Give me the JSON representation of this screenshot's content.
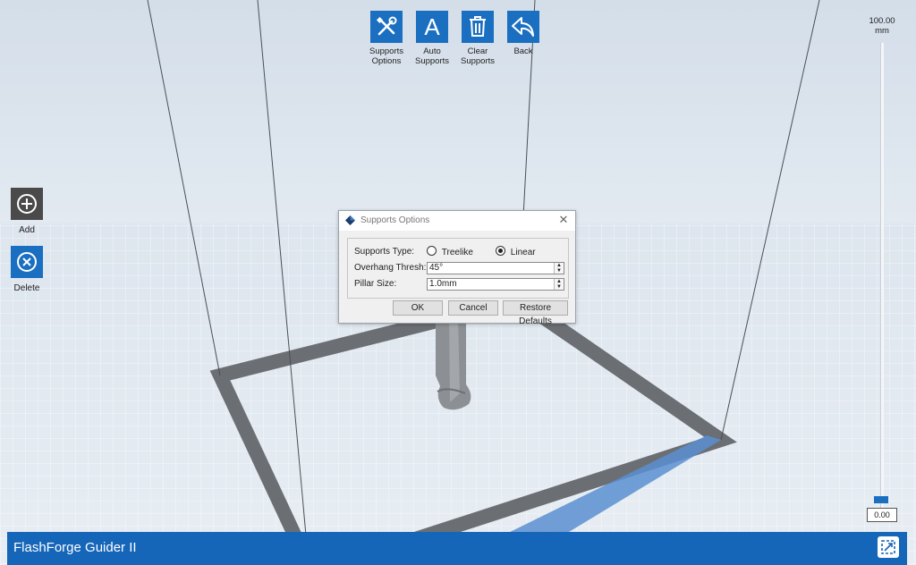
{
  "app": {
    "name": "FlashForge Guider II"
  },
  "toolbar": {
    "supports_options_label": "Supports\nOptions",
    "auto_supports_label": "Auto\nSupports",
    "clear_supports_label": "Clear\nSupports",
    "back_label": "Back",
    "auto_letter": "A"
  },
  "side": {
    "add_label": "Add",
    "delete_label": "Delete"
  },
  "slider": {
    "top_value": "100.00",
    "unit": "mm",
    "current_value": "0.00"
  },
  "dialog": {
    "title": "Supports Options",
    "close_glyph": "✕",
    "supports_type_label": "Supports Type:",
    "options": [
      "Treelike",
      "Linear"
    ],
    "selected": "Linear",
    "overhang_label": "Overhang Thresh:",
    "overhang_value": "45°",
    "pillar_label": "Pillar Size:",
    "pillar_value": "1.0mm",
    "ok": "OK",
    "cancel": "Cancel",
    "restore": "Restore Defaults"
  },
  "colors": {
    "accent": "#1a6fc0",
    "bottom_bar": "#1565b8",
    "side_add": "#4a4a4a",
    "side_delete": "#1a6fc0"
  },
  "icons": [
    "wrench-screwdriver-icon",
    "letter-a-icon",
    "trash-icon",
    "back-arrow-icon",
    "add-circle-icon",
    "delete-circle-icon",
    "app-logo-icon",
    "close-icon",
    "fit-view-icon"
  ]
}
